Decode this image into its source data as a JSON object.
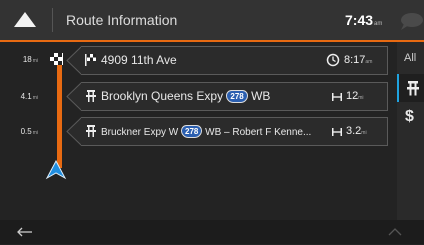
{
  "header": {
    "title": "Route Information",
    "time": "7:43",
    "time_suffix": "am",
    "menu_icon": "triangle-up-icon",
    "bubble_icon": "speech-bubble-icon"
  },
  "route_points": [
    {
      "distance": "18",
      "distance_unit": "mi",
      "icon": "checkered-flag-icon",
      "name": "4909 11th Ave",
      "eta_icon": "clock-icon",
      "eta": "8:17",
      "eta_suffix": "am"
    },
    {
      "distance": "4.1",
      "distance_unit": "mi",
      "icon": "highway-icon",
      "name": "Brooklyn Queens Expy",
      "shield": "278",
      "direction": "WB",
      "length_icon": "length-icon",
      "length": "12",
      "length_unit": "mi"
    },
    {
      "distance": "0.5",
      "distance_unit": "mi",
      "icon": "highway-icon",
      "name": "Bruckner Expy W",
      "shield": "278",
      "name_rest": "WB – Robert F Kenne...",
      "length_icon": "length-icon",
      "length": "3.2",
      "length_unit": "mi"
    }
  ],
  "right_tabs": {
    "all": "All",
    "road_icon": "highway-icon",
    "toll": "$"
  },
  "footer": {
    "back_icon": "back-arrow-icon",
    "up_icon": "chevron-up-icon"
  },
  "colors": {
    "accent": "#e86a12",
    "selected_tab": "#1fa3e0",
    "shield": "#2b5fb0"
  }
}
